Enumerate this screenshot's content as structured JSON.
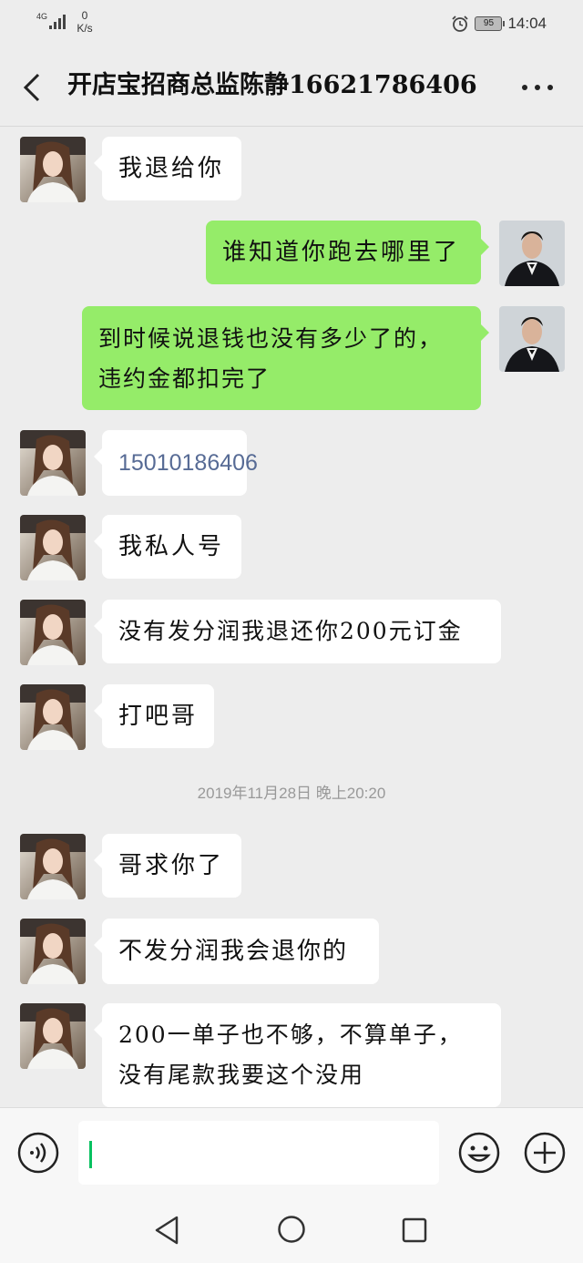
{
  "status_bar": {
    "network": "4G",
    "net_speed_value": "0",
    "net_speed_unit": "K/s",
    "battery": "95",
    "time": "14:04",
    "icons": [
      "signal-icon",
      "alarm-icon",
      "battery-icon"
    ]
  },
  "header": {
    "title": "开店宝招商总监陈静16621786406",
    "back_icon": "chevron-left-icon",
    "more_icon": "more-dots-icon"
  },
  "messages": [
    {
      "side": "in",
      "text": "我退给你"
    },
    {
      "side": "out",
      "text": "谁知道你跑去哪里了"
    },
    {
      "side": "out",
      "lines": [
        "到时候说退钱也没有多少了的，",
        "违约金都扣完了"
      ]
    },
    {
      "side": "in",
      "text": "15010186406",
      "link": true
    },
    {
      "side": "in",
      "text": "我私人号"
    },
    {
      "side": "in",
      "text": "没有发分润我退还你200元订金"
    },
    {
      "side": "in",
      "text": "打吧哥"
    },
    {
      "side": "in",
      "text": "哥求你了"
    },
    {
      "side": "in",
      "text": "不发分润我会退你的"
    },
    {
      "side": "in",
      "lines": [
        "200一单子也不够，不算单子，",
        "没有尾款我要这个没用"
      ]
    }
  ],
  "timestamp": "2019年11月28日 晚上20:20",
  "input_bar": {
    "value": "",
    "voice_icon": "voice-icon",
    "emoji_icon": "emoji-icon",
    "plus_icon": "plus-circle-icon"
  },
  "nav_bar": {
    "icons": [
      "nav-back-icon",
      "nav-home-icon",
      "nav-recent-icon"
    ]
  },
  "colors": {
    "background": "#ededed",
    "incoming_bubble": "#ffffff",
    "outgoing_bubble": "#95ec69",
    "link": "#576b95",
    "caret": "#07c160"
  }
}
